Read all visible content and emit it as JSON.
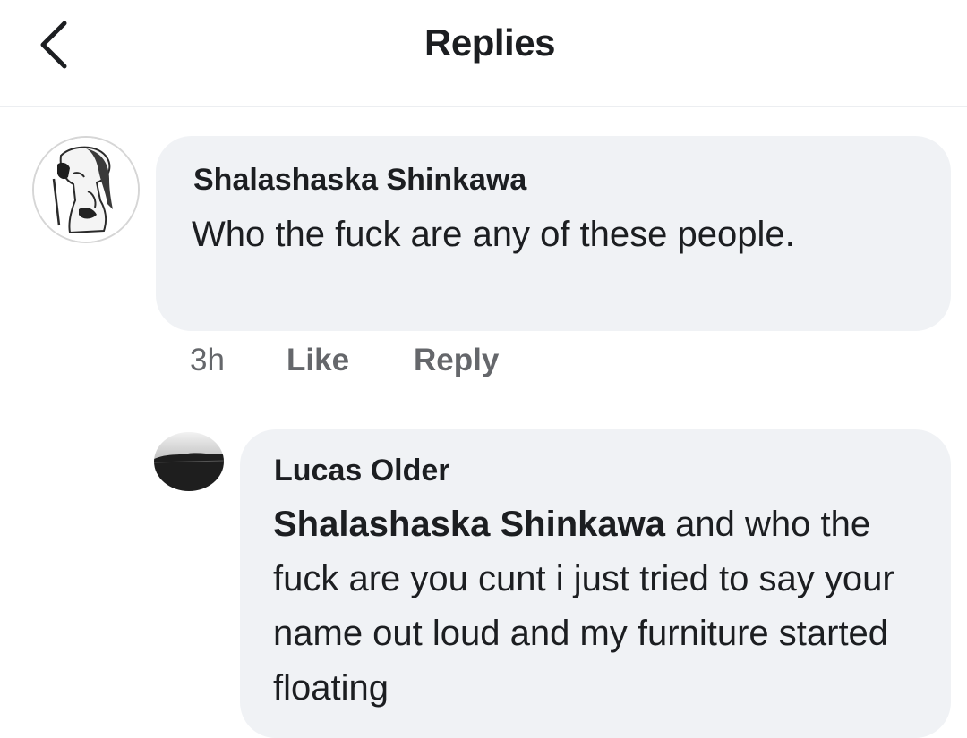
{
  "header": {
    "title": "Replies"
  },
  "comments": [
    {
      "author": "Shalashaska Shinkawa",
      "text": "Who the fuck are any of these people.",
      "time": "3h",
      "like_label": "Like",
      "reply_label": "Reply"
    },
    {
      "author": "Lucas Older",
      "mention": "Shalashaska Shinkawa",
      "text": " and who the fuck are you cunt i just tried to say your name out loud and my furniture started floating"
    }
  ],
  "colors": {
    "bubble": "#f0f2f5",
    "meta_text": "#65676b",
    "primary_text": "#1c1e21"
  }
}
